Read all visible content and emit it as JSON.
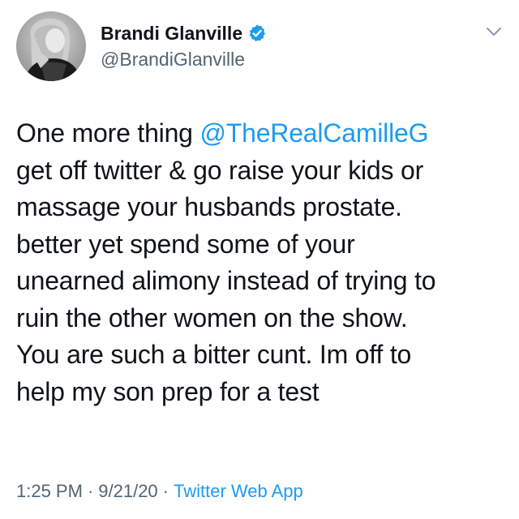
{
  "author": {
    "display_name": "Brandi Glanville",
    "handle": "@BrandiGlanville",
    "verified": true,
    "avatar_icon": "profile-photo"
  },
  "tweet": {
    "lines": [
      {
        "prefix": "One more thing ",
        "mention": "@TheRealCamilleG",
        "suffix": ""
      },
      {
        "text": "get off twitter & go raise your kids or"
      },
      {
        "text": "massage your husbands prostate."
      },
      {
        "text": "better yet spend some of your"
      },
      {
        "text": "unearned alimony instead of trying to"
      },
      {
        "text": "ruin the other women on the show."
      },
      {
        "text": "You are such a bitter cunt. Im off to"
      },
      {
        "text": "help my son prep for a test"
      }
    ]
  },
  "meta": {
    "time": "1:25 PM",
    "separator": "·",
    "date": "9/21/20",
    "source": "Twitter Web App"
  },
  "colors": {
    "link": "#1d9bf0",
    "secondary_text": "#536471",
    "primary_text": "#0f1419",
    "verified_badge": "#1d9bf0"
  },
  "icons": {
    "verified": "verified-badge-icon",
    "more": "chevron-down-icon"
  }
}
